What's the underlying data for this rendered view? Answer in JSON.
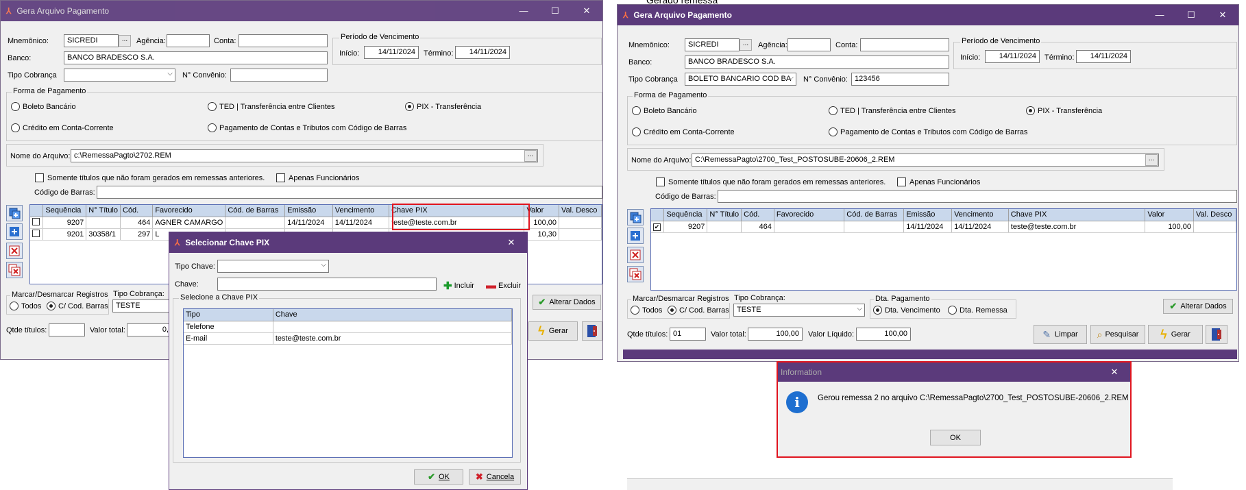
{
  "top_fragment": "Gerado remessa",
  "left_window": {
    "title": "Gera Arquivo Pagamento",
    "controls": {
      "min": "—",
      "max": "☐",
      "close": "✕"
    },
    "labels": {
      "mnemonico": "Mnemônico:",
      "agencia": "Agência:",
      "conta": "Conta:",
      "banco": "Banco:",
      "tipo_cobranca": "Tipo Cobrança",
      "n_convenio": "N° Convênio:",
      "periodo": "Período de Vencimento",
      "inicio": "Início:",
      "termino": "Término:",
      "forma": "Forma de Pagamento",
      "nome_arquivo": "Nome do Arquivo:",
      "codigo_barras": "Código de Barras:",
      "marcar": "Marcar/Desmarcar Registros",
      "tipo_cobranca2": "Tipo Cobrança:",
      "qtde": "Qtde títulos:",
      "valor_total": "Valor total:"
    },
    "values": {
      "mnemonico": "SICREDI",
      "agencia": "",
      "conta": "",
      "banco": "BANCO BRADESCO S.A.",
      "tipo_cobranca": "",
      "n_convenio": "",
      "inicio": "14/11/2024",
      "termino": "14/11/2024",
      "nome_arquivo": "c:\\RemessaPagto\\2702.REM",
      "codigo_barras": "",
      "tipo_cobranca2": "TESTE",
      "qtde": "",
      "valor_total": "0,"
    },
    "formas": [
      "Boleto Bancário",
      "TED | Transferência entre Clientes",
      "PIX - Transferência",
      "Crédito em Conta-Corrente",
      "Pagamento de Contas e Tributos com Código de Barras"
    ],
    "checks": {
      "somente": "Somente títulos que não foram gerados em remessas anteriores.",
      "apenas": "Apenas Funcionários"
    },
    "radios_marcar": [
      "Todos",
      "C/ Cod. Barras"
    ],
    "columns": [
      "Sequência",
      "N° Título",
      "Cód.",
      "Favorecido",
      "Cód. de Barras",
      "Emissão",
      "Vencimento",
      "Chave PIX",
      "Valor",
      "Val. Desco"
    ],
    "rows": [
      [
        "9207",
        "",
        "464",
        "AGNER CAMARGO",
        "",
        "14/11/2024",
        "14/11/2024",
        "teste@teste.com.br",
        "100,00",
        ""
      ],
      [
        "9201",
        "30358/1",
        "297",
        "L",
        "",
        "",
        "",
        "",
        "10,30",
        ""
      ]
    ],
    "buttons": {
      "alterar": "Alterar Dados",
      "gerar": "Gerar",
      "ellipsis": "..."
    }
  },
  "pix_dialog": {
    "title": "Selecionar Chave PIX",
    "labels": {
      "tipo_chave": "Tipo Chave:",
      "chave": "Chave:",
      "group": "Selecione a Chave PIX"
    },
    "values": {
      "tipo_chave": "",
      "chave": ""
    },
    "buttons": {
      "incluir": "Incluir",
      "excluir": "Excluir",
      "ok": "OK",
      "cancelar": "Cancela"
    },
    "columns": [
      "Tipo",
      "Chave"
    ],
    "rows": [
      [
        "Telefone",
        ""
      ],
      [
        "E-mail",
        "teste@teste.com.br"
      ]
    ]
  },
  "right_window": {
    "title": "Gera Arquivo Pagamento",
    "controls": {
      "min": "—",
      "max": "☐",
      "close": "✕"
    },
    "labels": {
      "mnemonico": "Mnemônico:",
      "agencia": "Agência:",
      "conta": "Conta:",
      "banco": "Banco:",
      "tipo_cobranca": "Tipo Cobrança",
      "n_convenio": "N° Convênio:",
      "periodo": "Período de Vencimento",
      "inicio": "Início:",
      "termino": "Término:",
      "forma": "Forma de Pagamento",
      "nome_arquivo": "Nome do Arquivo:",
      "codigo_barras": "Código de Barras:",
      "marcar": "Marcar/Desmarcar Registros",
      "tipo_cobranca2": "Tipo Cobrança:",
      "dta_pagamento": "Dta. Pagamento",
      "qtde": "Qtde títulos:",
      "valor_total": "Valor total:",
      "valor_liquido": "Valor Líquido:"
    },
    "values": {
      "mnemonico": "SICREDI",
      "agencia": "",
      "conta": "",
      "banco": "BANCO BRADESCO S.A.",
      "tipo_cobranca": "BOLETO BANCARIO COD BA",
      "n_convenio": "123456",
      "inicio": "14/11/2024",
      "termino": "14/11/2024",
      "nome_arquivo": "C:\\RemessaPagto\\2700_Test_POSTOSUBE-20606_2.REM",
      "codigo_barras": "",
      "tipo_cobranca2": "TESTE",
      "qtde": "01",
      "valor_total": "100,00",
      "valor_liquido": "100,00"
    },
    "formas": [
      "Boleto Bancário",
      "TED | Transferência entre Clientes",
      "PIX - Transferência",
      "Crédito em Conta-Corrente",
      "Pagamento de Contas e Tributos com Código de Barras"
    ],
    "checks": {
      "somente": "Somente títulos que não foram gerados em remessas anteriores.",
      "apenas": "Apenas Funcionários"
    },
    "radios_marcar": [
      "Todos",
      "C/ Cod. Barras"
    ],
    "radios_dta": [
      "Dta. Vencimento",
      "Dta. Remessa"
    ],
    "columns": [
      "Sequência",
      "N° Título",
      "Cód.",
      "Favorecido",
      "Cód. de Barras",
      "Emissão",
      "Vencimento",
      "Chave PIX",
      "Valor",
      "Val. Desco"
    ],
    "rows": [
      [
        "9207",
        "",
        "464",
        "",
        "",
        "14/11/2024",
        "14/11/2024",
        "teste@teste.com.br",
        "100,00",
        ""
      ]
    ],
    "buttons": {
      "alterar": "Alterar Dados",
      "limpar": "Limpar",
      "pesquisar": "Pesquisar",
      "gerar": "Gerar",
      "ellipsis": "..."
    }
  },
  "info_dialog": {
    "title": "Information",
    "message": "Gerou remessa 2 no arquivo C:\\RemessaPagto\\2700_Test_POSTOSUBE-20606_2.REM",
    "ok": "OK",
    "icon": "information-icon"
  },
  "colors": {
    "titlebar": "#5b3a7b",
    "highlight": "#e0141e",
    "grid_header": "#c9d8ec"
  }
}
